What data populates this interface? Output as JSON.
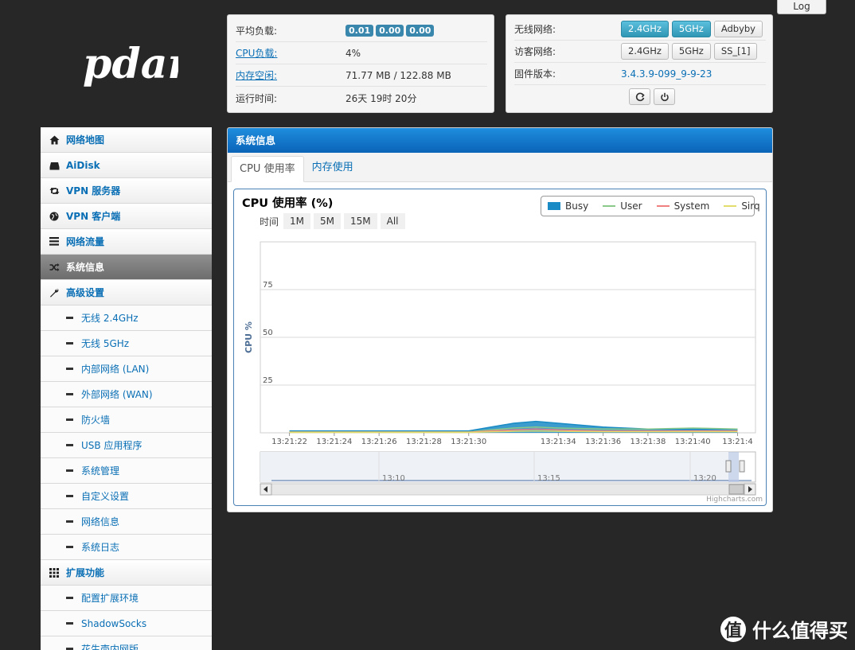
{
  "logo_text": "pdan",
  "log_button": "Log",
  "stats": {
    "load_label": "平均负载:",
    "load_values": [
      "0.01",
      "0.00",
      "0.00"
    ],
    "cpu_label": "CPU负载:",
    "cpu_value": "4%",
    "mem_label": "内存空闲:",
    "mem_value": "71.77 MB / 122.88 MB",
    "uptime_label": "运行时间:",
    "uptime_value": "26天 19时 20分"
  },
  "net": {
    "wireless_label": "无线网络:",
    "wireless_buttons": [
      "2.4GHz",
      "5GHz",
      "Adbyby"
    ],
    "guest_label": "访客网络:",
    "guest_buttons": [
      "2.4GHz",
      "5GHz",
      "SS_[1]"
    ],
    "fw_label": "固件版本:",
    "fw_value": "3.4.3.9-099_9-9-23"
  },
  "sidebar": {
    "items": [
      {
        "label": "网络地图",
        "icon": "home-icon"
      },
      {
        "label": "AiDisk",
        "icon": "hdd-icon"
      },
      {
        "label": "VPN 服务器",
        "icon": "retweet-icon"
      },
      {
        "label": "VPN 客户端",
        "icon": "globe-icon"
      },
      {
        "label": "网络流量",
        "icon": "list-icon"
      },
      {
        "label": "系统信息",
        "icon": "random-icon"
      },
      {
        "label": "高级设置",
        "icon": "wrench-icon"
      }
    ],
    "sub_advanced": [
      "无线 2.4GHz",
      "无线 5GHz",
      "内部网络 (LAN)",
      "外部网络 (WAN)",
      "防火墙",
      "USB 应用程序",
      "系统管理",
      "自定义设置",
      "网络信息",
      "系统日志"
    ],
    "ext_label": "扩展功能",
    "sub_ext": [
      "配置扩展环境",
      "ShadowSocks",
      "花生壳内网版"
    ]
  },
  "main": {
    "header": "系统信息",
    "tabs": [
      "CPU 使用率",
      "内存使用"
    ],
    "credit": "Highcharts.com"
  },
  "chart_data": {
    "type": "area",
    "title": "CPU 使用率 (%)",
    "ylabel": "CPU %",
    "ylim": [
      0,
      100
    ],
    "yticks": [
      25,
      50,
      75
    ],
    "range_label": "时间",
    "range_buttons": [
      "1M",
      "5M",
      "15M",
      "All"
    ],
    "x_ticks": [
      "13:21:22",
      "13:21:24",
      "13:21:26",
      "13:21:28",
      "13:21:30",
      "13:21:34",
      "13:21:36",
      "13:21:38",
      "13:21:40",
      "13:21:4"
    ],
    "navigator_ticks": [
      "13:10",
      "13:15",
      "13:20"
    ],
    "x": [
      "13:21:22",
      "13:21:24",
      "13:21:26",
      "13:21:28",
      "13:21:30",
      "13:21:31",
      "13:21:32",
      "13:21:33",
      "13:21:34",
      "13:21:36",
      "13:21:38",
      "13:21:40",
      "13:21:42"
    ],
    "series": [
      {
        "name": "Busy",
        "color": "#1a8bc4",
        "values": [
          1,
          1,
          1,
          1,
          1,
          3,
          5,
          6,
          5,
          3,
          2,
          2,
          2
        ]
      },
      {
        "name": "User",
        "color": "#8bc98b",
        "values": [
          0.5,
          0.5,
          0.5,
          0.5,
          0.5,
          1.5,
          2.5,
          3,
          2.5,
          2,
          2,
          2.5,
          2
        ]
      },
      {
        "name": "System",
        "color": "#f08080",
        "values": [
          0.3,
          0.3,
          0.3,
          0.3,
          0.3,
          1,
          1.5,
          2,
          1.5,
          1,
          1,
          1,
          1
        ]
      },
      {
        "name": "Sirq",
        "color": "#e2dd6d",
        "values": [
          0.2,
          0.2,
          0.2,
          0.2,
          0.2,
          0.5,
          0.8,
          1,
          0.8,
          0.6,
          0.6,
          0.6,
          0.6
        ]
      }
    ]
  },
  "watermark": "什么值得买"
}
